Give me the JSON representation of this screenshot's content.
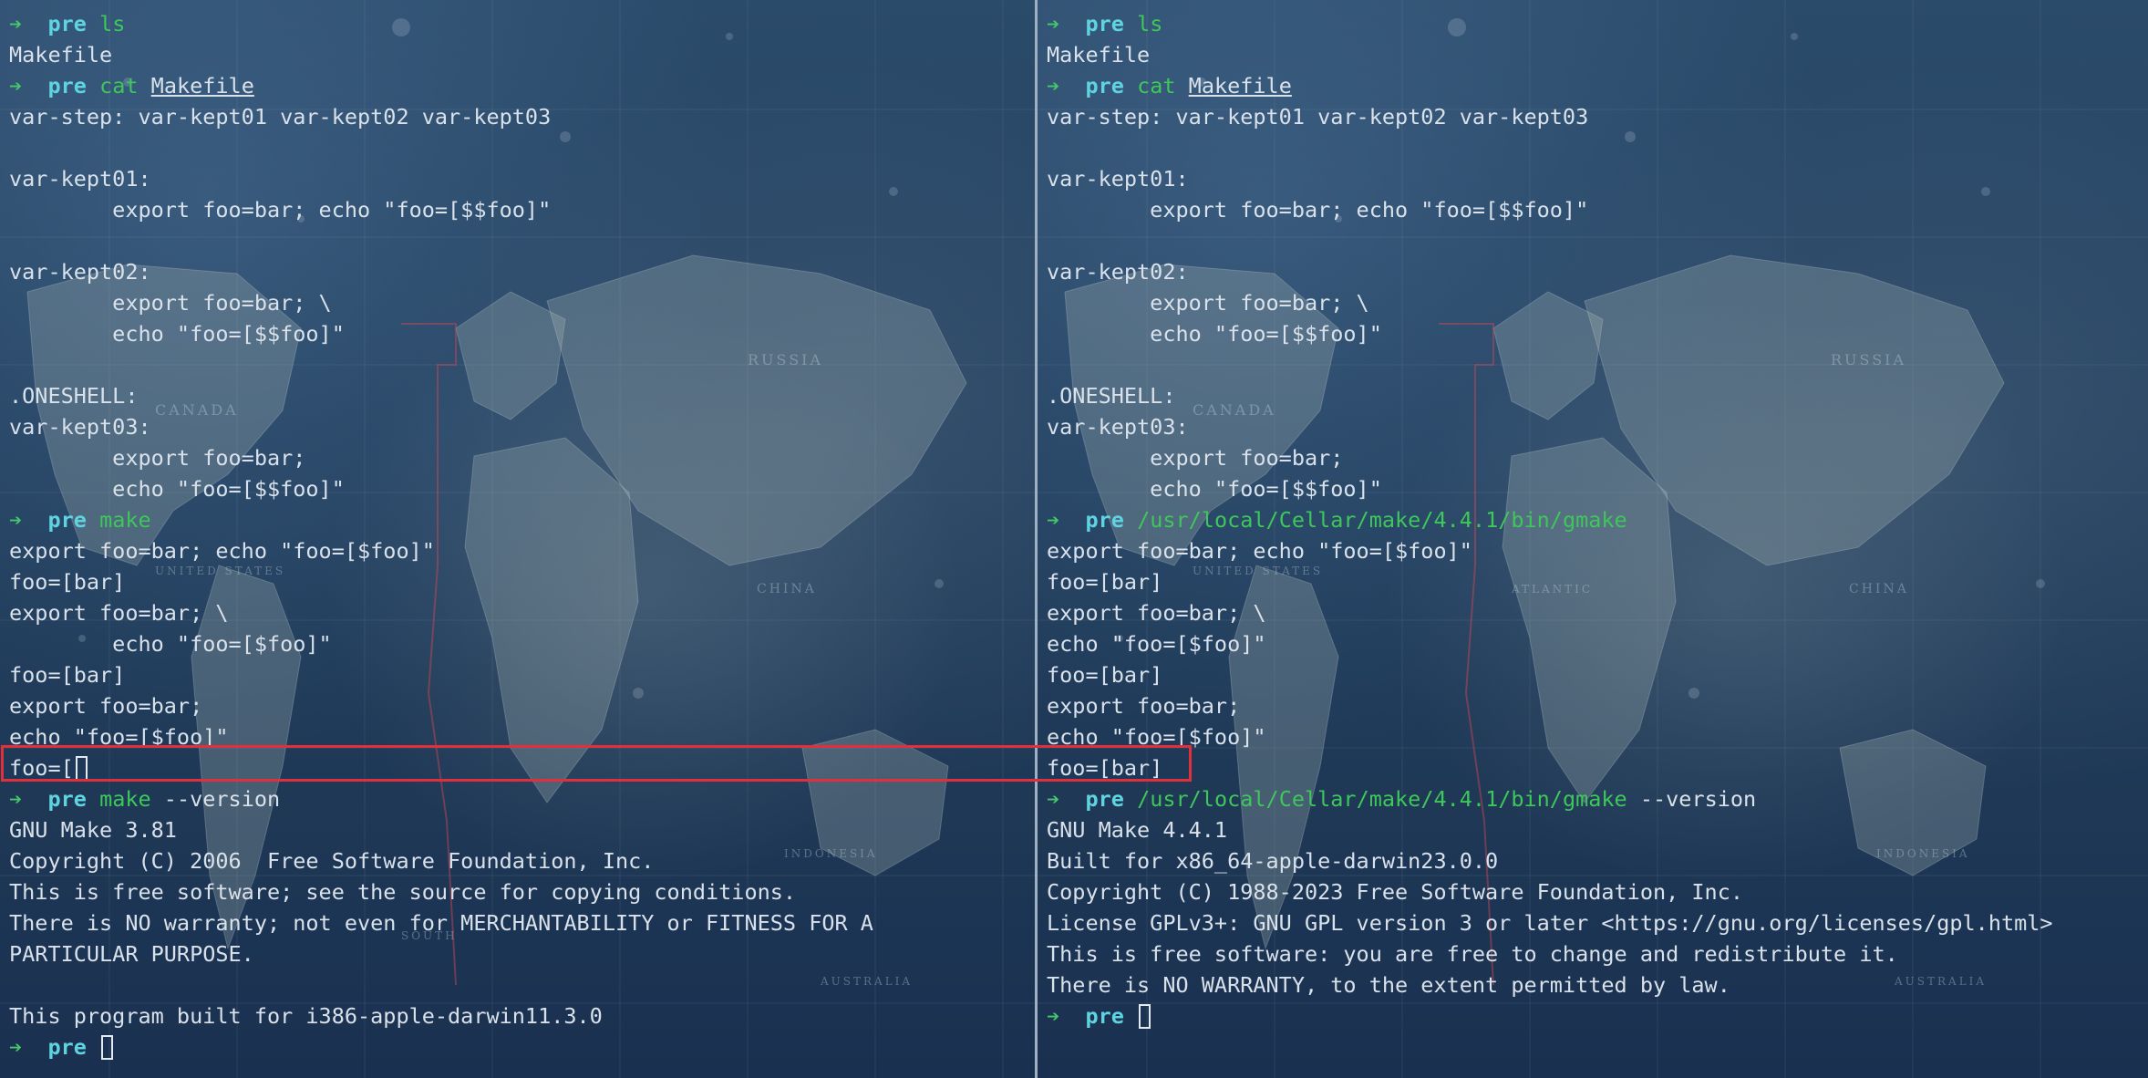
{
  "colors": {
    "prompt_arrow": "#45c96b",
    "prompt_dir": "#5fd3e0",
    "command": "#3ec75a",
    "text": "#d9e1ea",
    "highlight": "#e1303b",
    "background": "#1e3856"
  },
  "map_labels": {
    "russia": "RUSSIA",
    "canada": "CANADA",
    "united_states": "UNITED STATES",
    "china": "CHINA",
    "south": "SOUTH",
    "atlantic": "ATLANTIC",
    "australia": "AUSTRALIA",
    "indonesia": "INDONESIA"
  },
  "left_terminal": {
    "lines": [
      {
        "type": "prompt",
        "dir": "pre",
        "cmd": "ls",
        "args": ""
      },
      {
        "type": "output",
        "text": "Makefile"
      },
      {
        "type": "prompt",
        "dir": "pre",
        "cmd": "cat",
        "args": "Makefile",
        "underline": true
      },
      {
        "type": "output",
        "text": "var-step: var-kept01 var-kept02 var-kept03"
      },
      {
        "type": "output",
        "text": ""
      },
      {
        "type": "output",
        "text": "var-kept01:"
      },
      {
        "type": "output",
        "text": "        export foo=bar; echo \"foo=[$$foo]\""
      },
      {
        "type": "output",
        "text": ""
      },
      {
        "type": "output",
        "text": "var-kept02:"
      },
      {
        "type": "output",
        "text": "        export foo=bar; \\"
      },
      {
        "type": "output",
        "text": "        echo \"foo=[$$foo]\""
      },
      {
        "type": "output",
        "text": ""
      },
      {
        "type": "output",
        "text": ".ONESHELL:"
      },
      {
        "type": "output",
        "text": "var-kept03:"
      },
      {
        "type": "output",
        "text": "        export foo=bar;"
      },
      {
        "type": "output",
        "text": "        echo \"foo=[$$foo]\""
      },
      {
        "type": "prompt",
        "dir": "pre",
        "cmd": "make",
        "args": ""
      },
      {
        "type": "output",
        "text": "export foo=bar; echo \"foo=[$foo]\""
      },
      {
        "type": "output",
        "text": "foo=[bar]"
      },
      {
        "type": "output",
        "text": "export foo=bar; \\"
      },
      {
        "type": "output",
        "text": "        echo \"foo=[$foo]\""
      },
      {
        "type": "output",
        "text": "foo=[bar]"
      },
      {
        "type": "output",
        "text": "export foo=bar;"
      },
      {
        "type": "output",
        "text": "echo \"foo=[$foo]\""
      },
      {
        "type": "output_cursor",
        "text": "foo=["
      },
      {
        "type": "prompt",
        "dir": "pre",
        "cmd": "make",
        "args": " --version"
      },
      {
        "type": "output",
        "text": "GNU Make 3.81"
      },
      {
        "type": "output",
        "text": "Copyright (C) 2006  Free Software Foundation, Inc."
      },
      {
        "type": "output",
        "text": "This is free software; see the source for copying conditions."
      },
      {
        "type": "output",
        "text": "There is NO warranty; not even for MERCHANTABILITY or FITNESS FOR A"
      },
      {
        "type": "output",
        "text": "PARTICULAR PURPOSE."
      },
      {
        "type": "output",
        "text": ""
      },
      {
        "type": "output",
        "text": "This program built for i386-apple-darwin11.3.0"
      },
      {
        "type": "prompt_cursor",
        "dir": "pre"
      }
    ]
  },
  "right_terminal": {
    "lines": [
      {
        "type": "prompt",
        "dir": "pre",
        "cmd": "ls",
        "args": ""
      },
      {
        "type": "output",
        "text": "Makefile"
      },
      {
        "type": "prompt",
        "dir": "pre",
        "cmd": "cat",
        "args": "Makefile",
        "underline": true
      },
      {
        "type": "output",
        "text": "var-step: var-kept01 var-kept02 var-kept03"
      },
      {
        "type": "output",
        "text": ""
      },
      {
        "type": "output",
        "text": "var-kept01:"
      },
      {
        "type": "output",
        "text": "        export foo=bar; echo \"foo=[$$foo]\""
      },
      {
        "type": "output",
        "text": ""
      },
      {
        "type": "output",
        "text": "var-kept02:"
      },
      {
        "type": "output",
        "text": "        export foo=bar; \\"
      },
      {
        "type": "output",
        "text": "        echo \"foo=[$$foo]\""
      },
      {
        "type": "output",
        "text": ""
      },
      {
        "type": "output",
        "text": ".ONESHELL:"
      },
      {
        "type": "output",
        "text": "var-kept03:"
      },
      {
        "type": "output",
        "text": "        export foo=bar;"
      },
      {
        "type": "output",
        "text": "        echo \"foo=[$$foo]\""
      },
      {
        "type": "prompt",
        "dir": "pre",
        "cmd": "/usr/local/Cellar/make/4.4.1/bin/gmake",
        "args": ""
      },
      {
        "type": "output",
        "text": "export foo=bar; echo \"foo=[$foo]\""
      },
      {
        "type": "output",
        "text": "foo=[bar]"
      },
      {
        "type": "output",
        "text": "export foo=bar; \\"
      },
      {
        "type": "output",
        "text": "echo \"foo=[$foo]\""
      },
      {
        "type": "output",
        "text": "foo=[bar]"
      },
      {
        "type": "output",
        "text": "export foo=bar;"
      },
      {
        "type": "output",
        "text": "echo \"foo=[$foo]\""
      },
      {
        "type": "output",
        "text": "foo=[bar]"
      },
      {
        "type": "prompt",
        "dir": "pre",
        "cmd": "/usr/local/Cellar/make/4.4.1/bin/gmake",
        "args": " --version"
      },
      {
        "type": "output",
        "text": "GNU Make 4.4.1"
      },
      {
        "type": "output",
        "text": "Built for x86_64-apple-darwin23.0.0"
      },
      {
        "type": "output",
        "text": "Copyright (C) 1988-2023 Free Software Foundation, Inc."
      },
      {
        "type": "output",
        "text": "License GPLv3+: GNU GPL version 3 or later <https://gnu.org/licenses/gpl.html>"
      },
      {
        "type": "output",
        "text": "This is free software: you are free to change and redistribute it."
      },
      {
        "type": "output",
        "text": "There is NO WARRANTY, to the extent permitted by law."
      },
      {
        "type": "prompt_cursor",
        "dir": "pre"
      }
    ]
  }
}
